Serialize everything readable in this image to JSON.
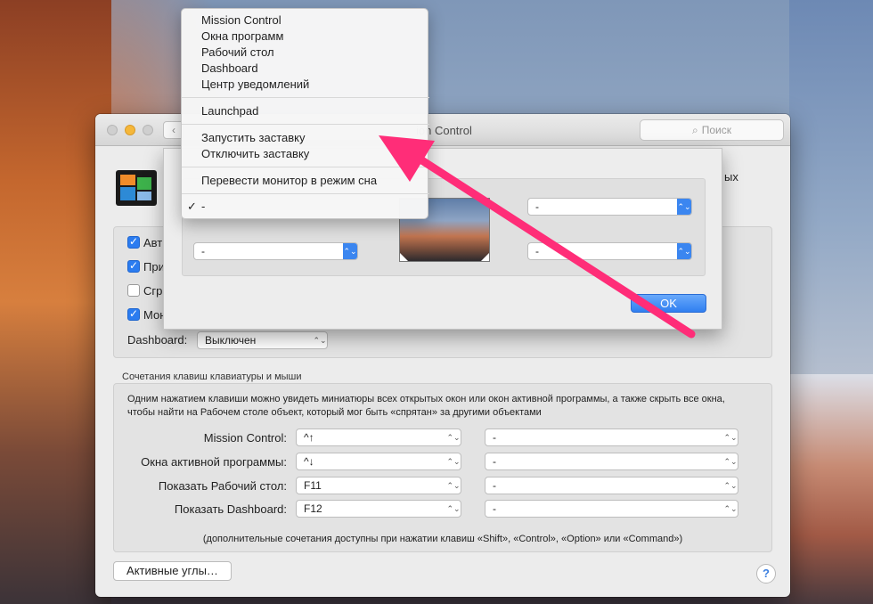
{
  "window": {
    "title": "ion Control",
    "back_icon": "‹",
    "search_placeholder": "Поиск",
    "search_icon": "⌕"
  },
  "partial_text": "ых",
  "checkboxes": [
    {
      "label": "Авт",
      "checked": true
    },
    {
      "label": "При",
      "checked": true
    },
    {
      "label": "Сгр",
      "checked": false
    },
    {
      "label": "Мон",
      "checked": true
    }
  ],
  "dashboard": {
    "label": "Dashboard:",
    "value": "Выключен",
    "chevron": "⌃⌄"
  },
  "shortcuts": {
    "section_label": "Сочетания клавиш клавиатуры и мыши",
    "description": "Одним нажатием клавиши можно увидеть миниатюры всех открытых окон или окон активной программы, а также скрыть все окна, чтобы найти на Рабочем столе объект, который мог быть «спрятан» за другими объектами",
    "rows": [
      {
        "label": "Mission Control:",
        "key": "^↑",
        "mouse": "-"
      },
      {
        "label": "Окна активной программы:",
        "key": "^↓",
        "mouse": "-"
      },
      {
        "label": "Показать Рабочий стол:",
        "key": "F11",
        "mouse": "-"
      },
      {
        "label": "Показать Dashboard:",
        "key": "F12",
        "mouse": "-"
      }
    ],
    "hint": "(дополнительные сочетания доступны при нажатии клавиш «Shift», «Control», «Option» или «Command»)"
  },
  "buttons": {
    "hot_corners": "Активные углы…",
    "help": "?"
  },
  "sheet": {
    "ok": "OK",
    "top_right": "-",
    "bottom_left": "-",
    "bottom_right": "-"
  },
  "menu": {
    "items": [
      "Mission Control",
      "Окна программ",
      "Рабочий стол",
      "Dashboard",
      "Центр уведомлений",
      "Launchpad",
      "Запустить заставку",
      "Отключить заставку",
      "Перевести монитор в режим сна",
      "-"
    ],
    "checkmark": "✓"
  },
  "colors": {
    "accent": "#2b7cf0",
    "arrow": "#ff2d78"
  }
}
